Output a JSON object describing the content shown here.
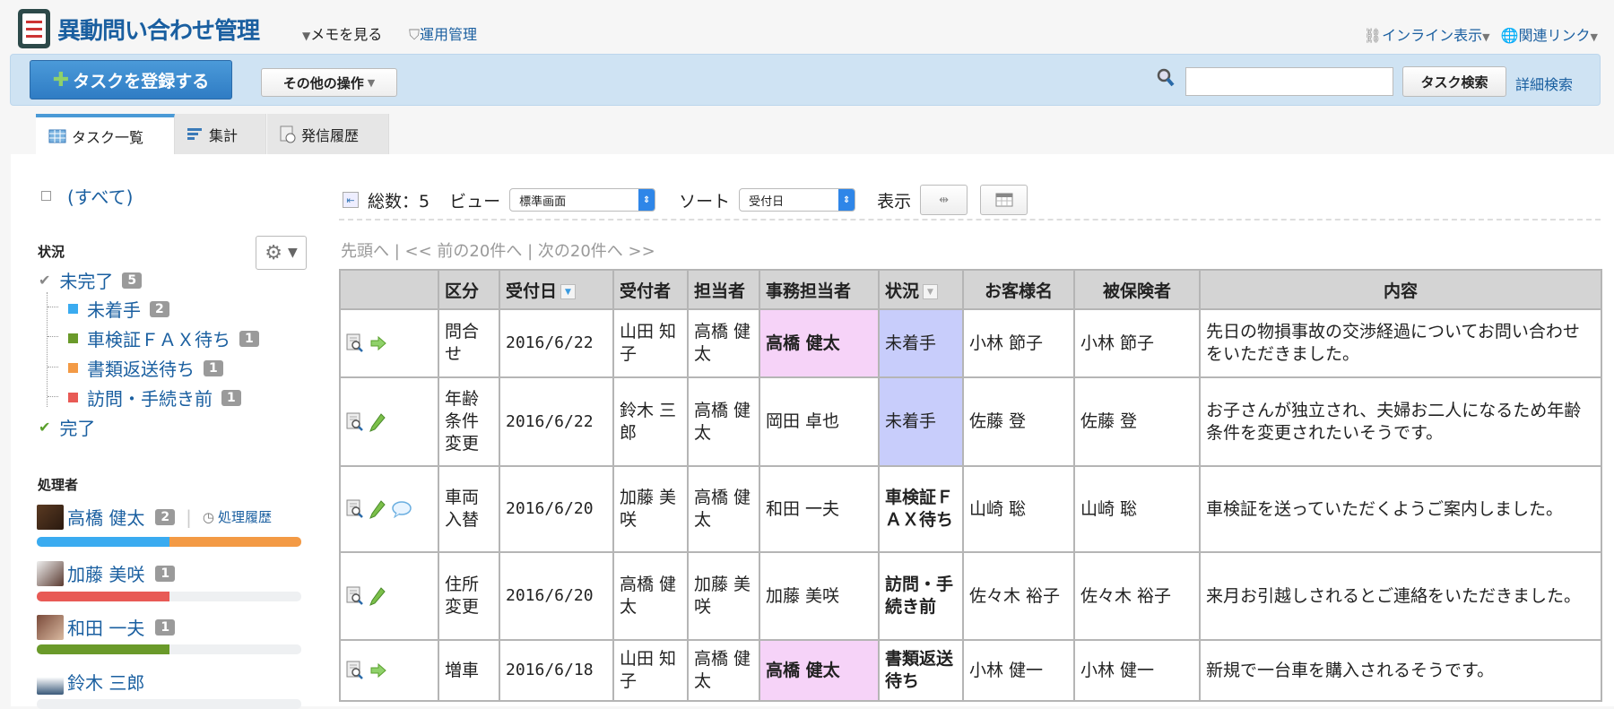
{
  "header": {
    "title": "異動問い合わせ管理",
    "memo_label": "メモを見る",
    "admin_label": "運用管理",
    "inline_label": "インライン表示",
    "related_label": "関連リンク"
  },
  "toolbar": {
    "register_label": "タスクを登録する",
    "other_label": "その他の操作",
    "search_value": "",
    "search_button": "タスク検索",
    "advanced_search": "詳細検索"
  },
  "tabs": [
    {
      "label": "タスク一覧"
    },
    {
      "label": "集計"
    },
    {
      "label": "発信履歴"
    }
  ],
  "sidebar": {
    "all_label": "(すべて)",
    "status_title": "状況",
    "statuses": [
      {
        "label": "未完了",
        "count": "5"
      },
      {
        "label": "未着手",
        "count": "2",
        "color": "#3aabf0"
      },
      {
        "label": "車検証ＦＡＸ待ち",
        "count": "1",
        "color": "#6a9a2a"
      },
      {
        "label": "書類返送待ち",
        "count": "1",
        "color": "#f39a45"
      },
      {
        "label": "訪問・手続き前",
        "count": "1",
        "color": "#e85a55"
      },
      {
        "label": "完了"
      }
    ],
    "handler_title": "処理者",
    "history_label": "処理履歴",
    "users": [
      {
        "name": "高橋 健太",
        "count": "2",
        "segments": [
          {
            "fraction": 0.5,
            "color": "#3aabf0"
          },
          {
            "fraction": 0.5,
            "color": "#f39a45"
          }
        ]
      },
      {
        "name": "加藤 美咲",
        "count": "1",
        "segments": [
          {
            "fraction": 0.5,
            "color": "#e85a55"
          }
        ]
      },
      {
        "name": "和田 一夫",
        "count": "1",
        "segments": [
          {
            "fraction": 0.5,
            "color": "#6a9a2a"
          }
        ]
      },
      {
        "name": "鈴木 三郎",
        "segments": []
      }
    ]
  },
  "main": {
    "total_label": "総数：5",
    "view_label": "ビュー",
    "view_value": "標準画面",
    "sort_label": "ソート",
    "sort_value": "受付日",
    "display_label": "表示",
    "pager": {
      "first": "先頭へ",
      "prev": "<< 前の20件へ",
      "next": "次の20件へ >>",
      "sep": "|"
    },
    "columns": [
      "",
      "区分",
      "受付日",
      "受付者",
      "担当者",
      "事務担当者",
      "状況",
      "お客様名",
      "被保険者",
      "内容"
    ],
    "rows": [
      {
        "icons": [
          "view",
          "arrow"
        ],
        "kubun": "問合せ",
        "date": "2016/6/22",
        "receiver": "山田 知子",
        "owner": "高橋 健太",
        "clerk": "高橋 健太",
        "clerk_hl": true,
        "status": "未着手",
        "status_style": "lav",
        "customer": "小林 節子",
        "insured": "小林 節子",
        "content": "先日の物損事故の交渉経過についてお問い合わせをいただきました。"
      },
      {
        "icons": [
          "view",
          "pencil"
        ],
        "kubun": "年齢条件変更",
        "date": "2016/6/22",
        "receiver": "鈴木 三郎",
        "owner": "高橋 健太",
        "clerk": "岡田 卓也",
        "clerk_hl": false,
        "status": "未着手",
        "status_style": "lav",
        "customer": "佐藤 登",
        "insured": "佐藤 登",
        "content": "お子さんが独立され、夫婦お二人になるため年齢条件を変更されたいそうです。"
      },
      {
        "icons": [
          "view",
          "pencil",
          "comment"
        ],
        "kubun": "車両入替",
        "date": "2016/6/20",
        "receiver": "加藤 美咲",
        "owner": "高橋 健太",
        "clerk": "和田 一夫",
        "clerk_hl": false,
        "status": "車検証ＦＡＸ待ち",
        "status_style": "bold",
        "customer": "山崎 聡",
        "insured": "山崎 聡",
        "content": "車検証を送っていただくようご案内しました。"
      },
      {
        "icons": [
          "view",
          "pencil"
        ],
        "kubun": "住所変更",
        "date": "2016/6/20",
        "receiver": "高橋 健太",
        "owner": "加藤 美咲",
        "clerk": "加藤 美咲",
        "clerk_hl": false,
        "status": "訪問・手続き前",
        "status_style": "bold",
        "customer": "佐々木 裕子",
        "insured": "佐々木 裕子",
        "content": "来月お引越しされるとご連絡をいただきました。"
      },
      {
        "icons": [
          "view",
          "arrow"
        ],
        "kubun": "増車",
        "date": "2016/6/18",
        "receiver": "山田 知子",
        "owner": "高橋 健太",
        "clerk": "高橋 健太",
        "clerk_hl": true,
        "status": "書類返送待ち",
        "status_style": "bold",
        "customer": "小林 健一",
        "insured": "小林 健一",
        "content": "新規で一台車を購入されるそうです。"
      }
    ]
  }
}
